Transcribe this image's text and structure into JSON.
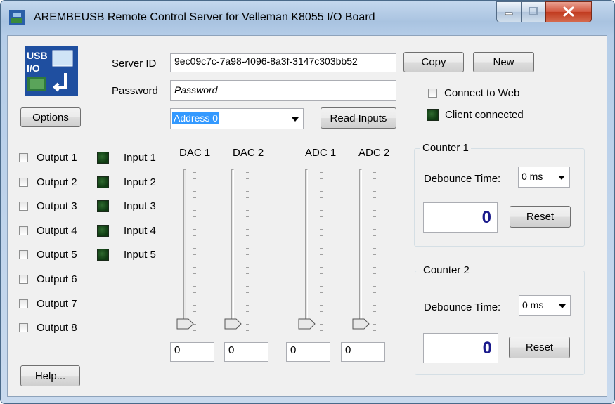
{
  "window": {
    "title": "AREMBEUSB Remote Control Server for Velleman K8055 I/O Board"
  },
  "logo": {
    "line1": "USB",
    "line2": "I/O"
  },
  "server": {
    "server_id_label": "Server ID",
    "server_id_value": "9ec09c7c-7a98-4096-8a3f-3147c303bb52",
    "password_label": "Password",
    "password_placeholder": "Password",
    "copy_label": "Copy",
    "new_label": "New",
    "address_value": "Address 0",
    "read_inputs_label": "Read Inputs",
    "connect_to_web_label": "Connect to Web",
    "connect_to_web_checked": false,
    "client_connected_label": "Client connected"
  },
  "options_label": "Options",
  "help_label": "Help...",
  "outputs": [
    "Output 1",
    "Output 2",
    "Output 3",
    "Output 4",
    "Output 5",
    "Output 6",
    "Output 7",
    "Output 8"
  ],
  "inputs": [
    "Input 1",
    "Input 2",
    "Input 3",
    "Input 4",
    "Input 5"
  ],
  "analog": {
    "dac1": {
      "label": "DAC 1",
      "value": "0"
    },
    "dac2": {
      "label": "DAC 2",
      "value": "0"
    },
    "adc1": {
      "label": "ADC 1",
      "value": "0"
    },
    "adc2": {
      "label": "ADC 2",
      "value": "0"
    }
  },
  "counter1": {
    "title": "Counter 1",
    "debounce_label": "Debounce Time:",
    "debounce_value": "0 ms",
    "count": "0",
    "reset_label": "Reset"
  },
  "counter2": {
    "title": "Counter 2",
    "debounce_label": "Debounce Time:",
    "debounce_value": "0 ms",
    "count": "0",
    "reset_label": "Reset"
  },
  "colors": {
    "counter_value": "#1a1a8c",
    "selection": "#3399ff",
    "led": "#1f4f1f"
  }
}
